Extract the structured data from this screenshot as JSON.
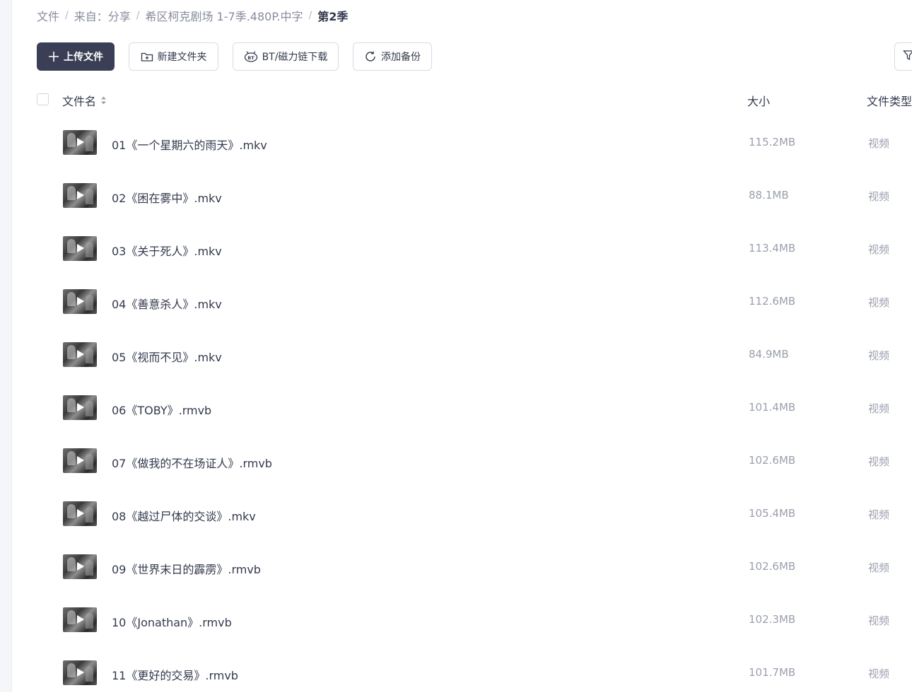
{
  "breadcrumb": {
    "items": [
      "文件",
      "来自：分享",
      "希区柯克剧场 1-7季.480P.中字"
    ],
    "current": "第2季",
    "separator": "/"
  },
  "toolbar": {
    "upload_label": "上传文件",
    "new_folder_label": "新建文件夹",
    "bt_label": "BT/磁力链下载",
    "backup_label": "添加备份"
  },
  "table": {
    "columns": {
      "name": "文件名",
      "size": "大小",
      "type": "文件类型"
    },
    "rows": [
      {
        "name": "01《一个星期六的雨天》.mkv",
        "size": "115.2MB",
        "type": "视频"
      },
      {
        "name": "02《困在雾中》.mkv",
        "size": "88.1MB",
        "type": "视频"
      },
      {
        "name": "03《关于死人》.mkv",
        "size": "113.4MB",
        "type": "视频"
      },
      {
        "name": "04《善意杀人》.mkv",
        "size": "112.6MB",
        "type": "视频"
      },
      {
        "name": "05《视而不见》.mkv",
        "size": "84.9MB",
        "type": "视频"
      },
      {
        "name": "06《TOBY》.rmvb",
        "size": "101.4MB",
        "type": "视频"
      },
      {
        "name": "07《做我的不在场证人》.rmvb",
        "size": "102.6MB",
        "type": "视频"
      },
      {
        "name": "08《越过尸体的交谈》.mkv",
        "size": "105.4MB",
        "type": "视频"
      },
      {
        "name": "09《世界末日的霹雳》.rmvb",
        "size": "102.6MB",
        "type": "视频"
      },
      {
        "name": "10《Jonathan》.rmvb",
        "size": "102.3MB",
        "type": "视频"
      },
      {
        "name": "11《更好的交易》.rmvb",
        "size": "101.7MB",
        "type": "视频"
      }
    ]
  },
  "colors": {
    "primary_button": "#3a3f55",
    "muted_text": "#9a9fad"
  }
}
